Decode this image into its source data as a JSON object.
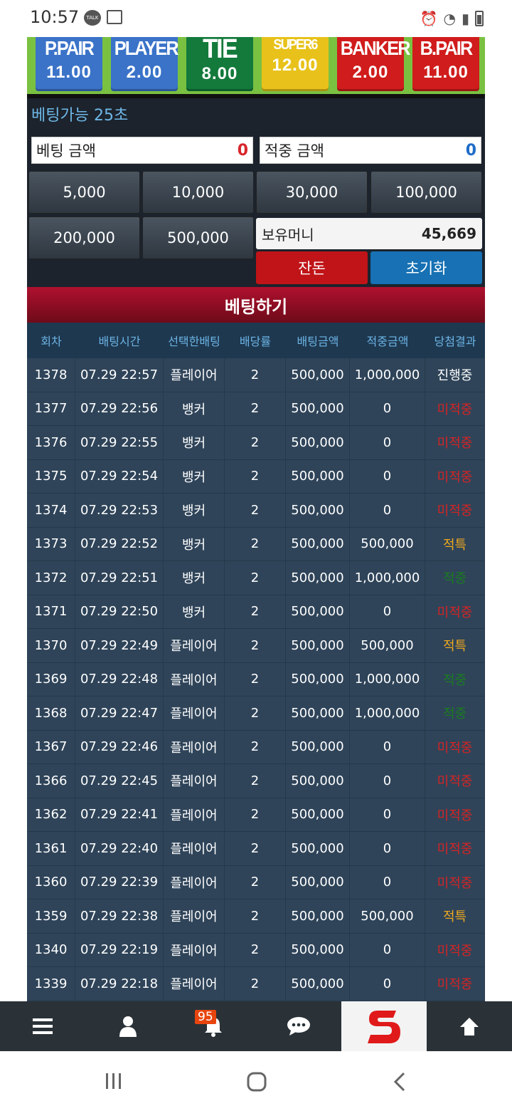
{
  "status": {
    "time": "10:57",
    "talk_icon": "talk-icon",
    "gallery_icon": "image-icon"
  },
  "odds": [
    {
      "name": "P.PAIR",
      "value": "11.00",
      "color": "#3a73c8"
    },
    {
      "name": "PLAYER",
      "value": "2.00",
      "color": "#3a73c8"
    },
    {
      "name": "TIE",
      "value": "8.00",
      "color": "#137a3b"
    },
    {
      "name": "SUPER6",
      "value": "12.00",
      "color": "#e8c21a"
    },
    {
      "name": "BANKER",
      "value": "2.00",
      "color": "#d01c1c"
    },
    {
      "name": "B.PAIR",
      "value": "11.00",
      "color": "#d01c1c"
    }
  ],
  "betting": {
    "available_label": "베팅가능",
    "available_time": "25초",
    "bet_amount_label": "베팅 금액",
    "bet_amount_value": "0",
    "win_amount_label": "적중 금액",
    "win_amount_value": "0",
    "chips": [
      "5,000",
      "10,000",
      "30,000",
      "100,000",
      "200,000",
      "500,000"
    ],
    "balance_label": "보유머니",
    "balance_value": "45,669",
    "change_label": "잔돈",
    "reset_label": "초기화",
    "bet_button_label": "베팅하기"
  },
  "table": {
    "headers": [
      "회차",
      "배팅시간",
      "선택한배팅",
      "배당률",
      "배팅금액",
      "적중금액",
      "당첨결과"
    ],
    "rows": [
      {
        "round": "1378",
        "time": "07.29 22:57",
        "pick": "플레이어",
        "odds": "2",
        "bet": "500,000",
        "win": "1,000,000",
        "result": "진행중"
      },
      {
        "round": "1377",
        "time": "07.29 22:56",
        "pick": "뱅커",
        "odds": "2",
        "bet": "500,000",
        "win": "0",
        "result": "미적중"
      },
      {
        "round": "1376",
        "time": "07.29 22:55",
        "pick": "뱅커",
        "odds": "2",
        "bet": "500,000",
        "win": "0",
        "result": "미적중"
      },
      {
        "round": "1375",
        "time": "07.29 22:54",
        "pick": "뱅커",
        "odds": "2",
        "bet": "500,000",
        "win": "0",
        "result": "미적중"
      },
      {
        "round": "1374",
        "time": "07.29 22:53",
        "pick": "뱅커",
        "odds": "2",
        "bet": "500,000",
        "win": "0",
        "result": "미적중"
      },
      {
        "round": "1373",
        "time": "07.29 22:52",
        "pick": "뱅커",
        "odds": "2",
        "bet": "500,000",
        "win": "500,000",
        "result": "적특"
      },
      {
        "round": "1372",
        "time": "07.29 22:51",
        "pick": "뱅커",
        "odds": "2",
        "bet": "500,000",
        "win": "1,000,000",
        "result": "적중"
      },
      {
        "round": "1371",
        "time": "07.29 22:50",
        "pick": "뱅커",
        "odds": "2",
        "bet": "500,000",
        "win": "0",
        "result": "미적중"
      },
      {
        "round": "1370",
        "time": "07.29 22:49",
        "pick": "플레이어",
        "odds": "2",
        "bet": "500,000",
        "win": "500,000",
        "result": "적특"
      },
      {
        "round": "1369",
        "time": "07.29 22:48",
        "pick": "플레이어",
        "odds": "2",
        "bet": "500,000",
        "win": "1,000,000",
        "result": "적중"
      },
      {
        "round": "1368",
        "time": "07.29 22:47",
        "pick": "플레이어",
        "odds": "2",
        "bet": "500,000",
        "win": "1,000,000",
        "result": "적중"
      },
      {
        "round": "1367",
        "time": "07.29 22:46",
        "pick": "플레이어",
        "odds": "2",
        "bet": "500,000",
        "win": "0",
        "result": "미적중"
      },
      {
        "round": "1366",
        "time": "07.29 22:45",
        "pick": "플레이어",
        "odds": "2",
        "bet": "500,000",
        "win": "0",
        "result": "미적중"
      },
      {
        "round": "1362",
        "time": "07.29 22:41",
        "pick": "플레이어",
        "odds": "2",
        "bet": "500,000",
        "win": "0",
        "result": "미적중"
      },
      {
        "round": "1361",
        "time": "07.29 22:40",
        "pick": "플레이어",
        "odds": "2",
        "bet": "500,000",
        "win": "0",
        "result": "미적중"
      },
      {
        "round": "1360",
        "time": "07.29 22:39",
        "pick": "플레이어",
        "odds": "2",
        "bet": "500,000",
        "win": "0",
        "result": "미적중"
      },
      {
        "round": "1359",
        "time": "07.29 22:38",
        "pick": "플레이어",
        "odds": "2",
        "bet": "500,000",
        "win": "500,000",
        "result": "적특"
      },
      {
        "round": "1340",
        "time": "07.29 22:19",
        "pick": "플레이어",
        "odds": "2",
        "bet": "500,000",
        "win": "0",
        "result": "미적중"
      },
      {
        "round": "1339",
        "time": "07.29 22:18",
        "pick": "플레이어",
        "odds": "2",
        "bet": "500,000",
        "win": "0",
        "result": "미적중"
      }
    ]
  },
  "nav": {
    "items": [
      "menu-icon",
      "user-icon",
      "bell-icon",
      "chat-icon",
      "logo",
      "arrow-up-icon"
    ],
    "badge_count": "95",
    "logo_letter": "S"
  },
  "sysnav": [
    "recent-apps-icon",
    "home-icon",
    "back-icon"
  ]
}
